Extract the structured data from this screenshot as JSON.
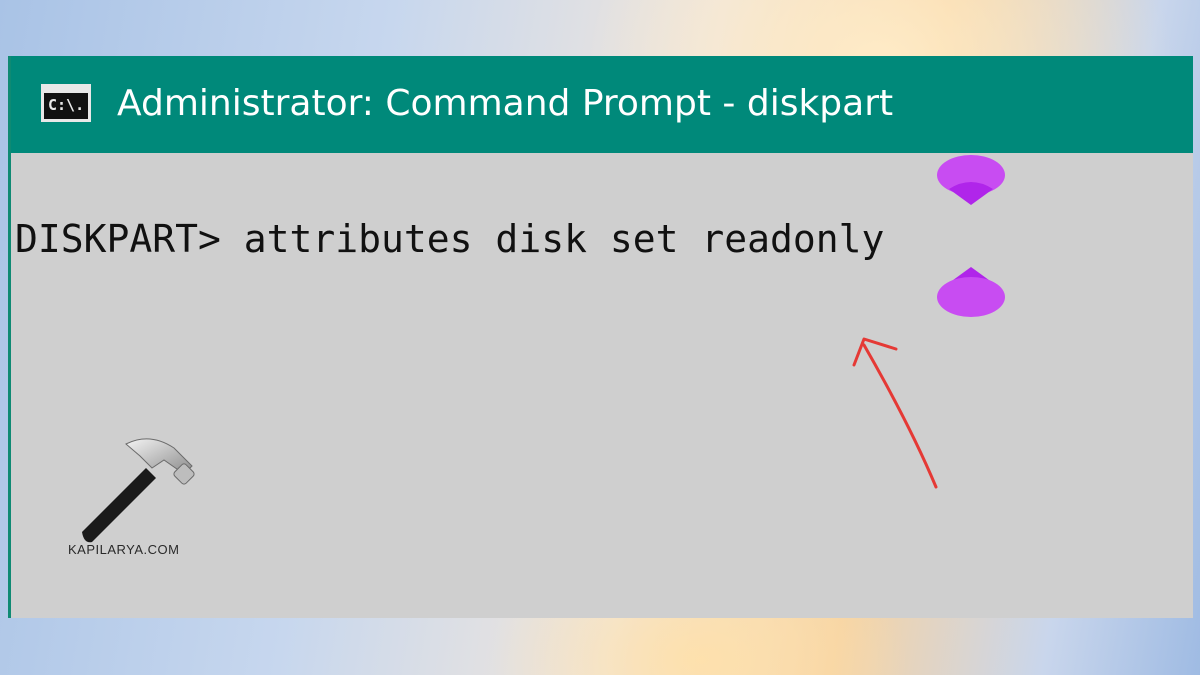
{
  "window": {
    "title": "Administrator: Command Prompt - diskpart",
    "icon": "cmd-icon",
    "icon_glyph": "C:\\."
  },
  "console": {
    "prompt": "DISKPART>",
    "command": "attributes disk set readonly",
    "line": "DISKPART> attributes disk set readonly"
  },
  "annotations": {
    "arrow": "red-arrow-icon",
    "text_cursor": "text-selection-cursor-icon"
  },
  "watermark": {
    "text": "KAPILARYA.COM",
    "icon": "hammer-icon"
  },
  "colors": {
    "titlebar": "#00897a",
    "console_bg": "#cfcfcf",
    "console_text": "#111111",
    "arrow": "#e53935",
    "cursor": "#c040f0"
  }
}
